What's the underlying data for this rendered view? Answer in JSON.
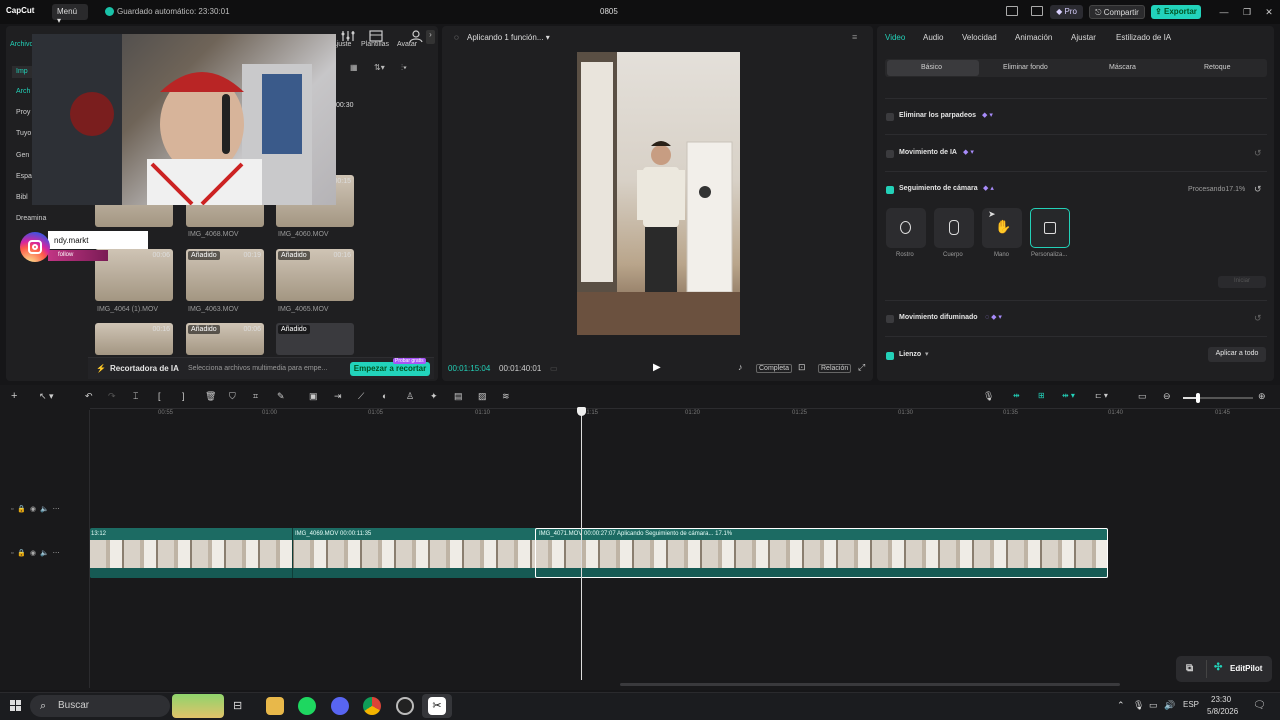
{
  "titlebar": {
    "logo": "CapCut",
    "menu": "Menú",
    "autosave": "Guardado automático: 23:30:01",
    "project": "0805",
    "pro": "Pro",
    "share": "Compartir",
    "export": "Exportar"
  },
  "media": {
    "toolbar": [
      {
        "label": "Archivo",
        "icon": "folder-icon"
      },
      {
        "label": "Ajuste",
        "icon": "sliders-icon"
      },
      {
        "label": "Plantillas",
        "icon": "template-icon"
      },
      {
        "label": "Avatar",
        "icon": "avatar-icon"
      }
    ],
    "sidebar": [
      "Imp",
      "Arch",
      "Proy",
      "Tuyo",
      "Gen",
      "Espa",
      "Bibl",
      "Dreamina"
    ],
    "clips": [
      {
        "name": "IMG_4068.MOV",
        "badge": "",
        "dur": ""
      },
      {
        "name": "IMG_4060.MOV",
        "badge": "",
        "dur": "00:15"
      },
      {
        "name": "IMG_4064 (1).MOV",
        "badge": "",
        "dur": "00:06"
      },
      {
        "name": "IMG_4063.MOV",
        "badge": "Añadido",
        "dur": "00:19"
      },
      {
        "name": "IMG_4065.MOV",
        "badge": "Añadido",
        "dur": "00:16"
      },
      {
        "name": "",
        "badge": "",
        "dur": "00:16"
      },
      {
        "name": "",
        "badge": "Añadido",
        "dur": "00:06"
      },
      {
        "name": "",
        "badge": "Añadido",
        "dur": ""
      }
    ],
    "first_dur": "00:30",
    "ai_cropper": "Recortadora de IA",
    "ai_hint": "Selecciona archivos multimedia para empe...",
    "ai_button": "Empezar a recortar",
    "ai_badge": "Probar gratis",
    "instagram_handle": "ndy.markt",
    "instagram_follow": "follow"
  },
  "player": {
    "title": "Aplicando 1 función...",
    "current": "00:01:15:04",
    "total": "00:01:40:01",
    "full_label": "Completa",
    "ratio_label": "Relación"
  },
  "props": {
    "tabs": [
      "Video",
      "Audio",
      "Velocidad",
      "Animación",
      "Ajustar",
      "Estilizado de IA"
    ],
    "subtabs": [
      "Básico",
      "Eliminar fondo",
      "Máscara",
      "Retoque"
    ],
    "blink": "Eliminar los parpadeos",
    "ai_motion": "Movimiento de IA",
    "camera_track": "Seguimiento de cámara",
    "processing": "Procesando17.1%",
    "track_options": [
      "Rostro",
      "Cuerpo",
      "Mano",
      "Personaliza..."
    ],
    "motion_blur": "Movimiento difuminado",
    "canvas": "Lienzo",
    "apply_all": "Aplicar a todo",
    "start_small": "Iniciar"
  },
  "timeline": {
    "ruler": [
      "00:55",
      "01:00",
      "01:05",
      "01:10",
      "01:15",
      "01:20",
      "01:25",
      "01:30",
      "01:35",
      "01:40",
      "01:45"
    ],
    "segments": [
      {
        "label": "13:12"
      },
      {
        "label": "IMG_4069.MOV   00:00:11:35"
      },
      {
        "label": "IMG_4071.MOV   00:00:27:07   Aplicando Seguimiento de cámara... 17.1%"
      }
    ],
    "editpilot": "EditPilot"
  },
  "taskbar": {
    "search": "Buscar",
    "lang": "ESP",
    "time": "23:30",
    "date": "5/8/2026"
  },
  "colors": {
    "accent": "#23d1b8",
    "clip_track": "#1c6b63"
  }
}
